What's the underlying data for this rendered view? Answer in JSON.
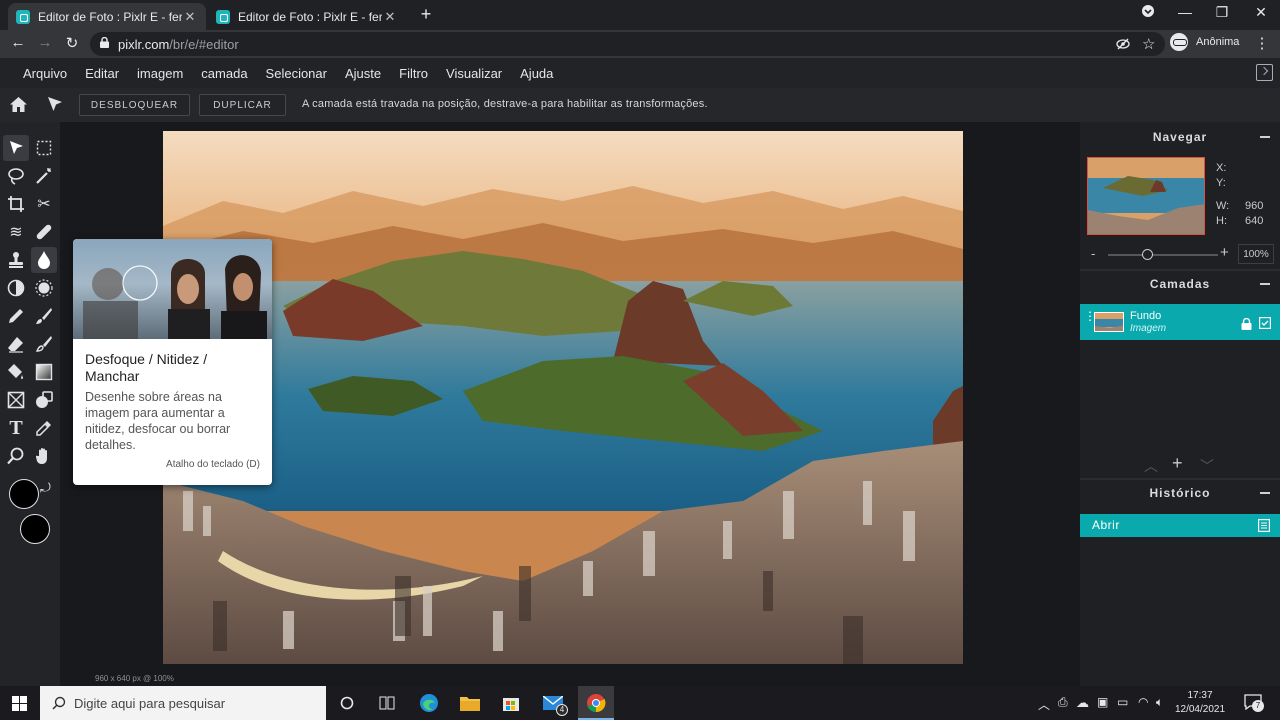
{
  "browser": {
    "tabs": [
      {
        "title": "Editor de Foto : Pixlr E - ferramen",
        "active": true
      },
      {
        "title": "Editor de Foto : Pixlr E - ferramen",
        "active": false
      }
    ],
    "url_host": "pixlr.com",
    "url_path": "/br/e/#editor",
    "profile_label": "Anônima"
  },
  "menubar": [
    "Arquivo",
    "Editar",
    "imagem",
    "camada",
    "Selecionar",
    "Ajuste",
    "Filtro",
    "Visualizar",
    "Ajuda"
  ],
  "optbar": {
    "unlock_label": "DESBLOQUEAR",
    "duplicate_label": "DUPLICAR",
    "lock_message": "A camada está travada na posição, destrave-a para habilitar as transformações."
  },
  "tooltip": {
    "title": "Desfoque / Nitidez / Manchar",
    "description": "Desenhe sobre áreas na imagem para aumentar a nitidez, desfocar ou borrar detalhes.",
    "shortcut": "Atalho do teclado (D)"
  },
  "statusline": "960 x 640 px @ 100%",
  "colors": {
    "accent": "#0aa9ad",
    "foreground": "#000000",
    "background": "#000000"
  },
  "navigator": {
    "title": "Navegar",
    "x_label": "X:",
    "y_label": "Y:",
    "w_label": "W:",
    "w_value": "960",
    "h_label": "H:",
    "h_value": "640",
    "zoom_minus": "-",
    "zoom_plus": "+",
    "zoom_pct": "100%",
    "zoom_level": 0.35
  },
  "layers": {
    "title": "Camadas",
    "items": [
      {
        "name": "Fundo",
        "type": "Imagem"
      }
    ]
  },
  "history": {
    "title": "Histórico",
    "items": [
      {
        "label": "Abrir"
      }
    ]
  },
  "taskbar": {
    "search_placeholder": "Digite aqui para pesquisar",
    "mail_badge": "4",
    "time": "17:37",
    "date": "12/04/2021",
    "notif_count": "7"
  }
}
